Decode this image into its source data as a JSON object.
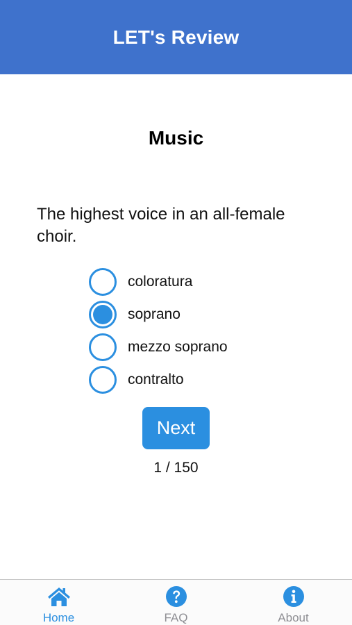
{
  "header": {
    "title": "LET's Review"
  },
  "quiz": {
    "subject": "Music",
    "question": "The highest voice in an all-female choir.",
    "options": [
      {
        "label": "coloratura",
        "selected": false
      },
      {
        "label": "soprano",
        "selected": true
      },
      {
        "label": "mezzo soprano",
        "selected": false
      },
      {
        "label": "contralto",
        "selected": false
      }
    ],
    "next_label": "Next",
    "progress": "1 / 150"
  },
  "tabbar": {
    "tabs": [
      {
        "label": "Home",
        "icon": "home-icon",
        "active": true
      },
      {
        "label": "FAQ",
        "icon": "question-circle-icon",
        "active": false
      },
      {
        "label": "About",
        "icon": "info-circle-icon",
        "active": false
      }
    ]
  },
  "colors": {
    "header_bg": "#3f72cc",
    "accent": "#2b8fe0",
    "inactive_tab": "#8e8e93"
  }
}
